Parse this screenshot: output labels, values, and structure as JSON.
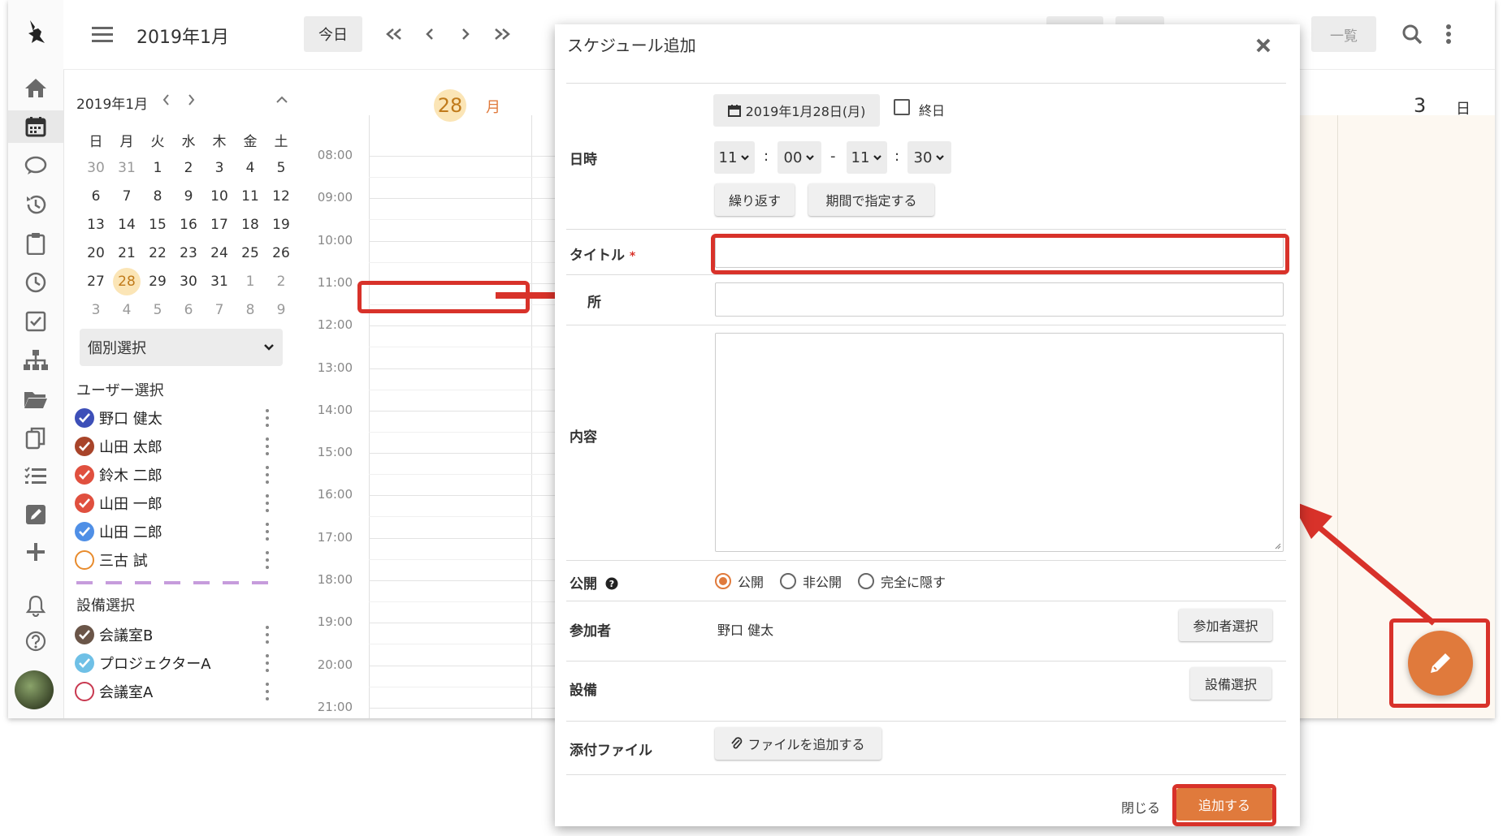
{
  "header": {
    "month_title": "2019年1月",
    "today_button": "今日",
    "view_list_label": "一覧"
  },
  "mini_calendar": {
    "title": "2019年1月",
    "weekdays": [
      "日",
      "月",
      "火",
      "水",
      "木",
      "金",
      "土"
    ],
    "weeks": [
      [
        "30",
        "31",
        "1",
        "2",
        "3",
        "4",
        "5"
      ],
      [
        "6",
        "7",
        "8",
        "9",
        "10",
        "11",
        "12"
      ],
      [
        "13",
        "14",
        "15",
        "16",
        "17",
        "18",
        "19"
      ],
      [
        "20",
        "21",
        "22",
        "23",
        "24",
        "25",
        "26"
      ],
      [
        "27",
        "28",
        "29",
        "30",
        "31",
        "1",
        "2"
      ],
      [
        "3",
        "4",
        "5",
        "6",
        "7",
        "8",
        "9"
      ]
    ],
    "today": "28"
  },
  "sidebar": {
    "group_select": "個別選択",
    "user_section": "ユーザー選択",
    "users": [
      {
        "name": "野口 健太",
        "color": "#3d4fb8",
        "checked": true
      },
      {
        "name": "山田 太郎",
        "color": "#a8442a",
        "checked": true
      },
      {
        "name": "鈴木 二郎",
        "color": "#e0503f",
        "checked": true
      },
      {
        "name": "山田 一郎",
        "color": "#e0503f",
        "checked": true
      },
      {
        "name": "山田 二郎",
        "color": "#4f8fe6",
        "checked": true
      },
      {
        "name": "三古 試",
        "color": "#e88b2d",
        "checked": false
      }
    ],
    "facility_section": "設備選択",
    "facilities": [
      {
        "name": "会議室B",
        "color": "#6a5548",
        "checked": true
      },
      {
        "name": "プロジェクターA",
        "color": "#6fc0e6",
        "checked": true
      },
      {
        "name": "会議室A",
        "color": "#c8384f",
        "checked": false
      }
    ]
  },
  "day_view": {
    "day_number": "28",
    "day_weekday": "月",
    "right_day_number": "3",
    "right_day_weekday": "日",
    "times": [
      "08:00",
      "09:00",
      "10:00",
      "11:00",
      "12:00",
      "13:00",
      "14:00",
      "15:00",
      "16:00",
      "17:00",
      "18:00",
      "19:00",
      "20:00",
      "21:00"
    ]
  },
  "modal": {
    "title": "スケジュール追加",
    "datetime_label": "日時",
    "date_button": "2019年1月28日(月)",
    "allday_label": "終日",
    "start_hour": "11",
    "start_min": "00",
    "end_hour": "11",
    "end_min": "30",
    "time_sep": ":",
    "range_sep": "-",
    "repeat_button": "繰り返す",
    "period_button": "期間で指定する",
    "title_label": "タイトル",
    "required_mark": "*",
    "place_label_partial": "所",
    "content_label": "内容",
    "visibility_label": "公開",
    "visibility_options": [
      "公開",
      "非公開",
      "完全に隠す"
    ],
    "participants_label": "参加者",
    "participant_name": "野口 健太",
    "participant_button": "参加者選択",
    "facility_label": "設備",
    "facility_button": "設備選択",
    "attachment_label": "添付ファイル",
    "attachment_button": "ファイルを追加する",
    "close_button": "閉じる",
    "add_button": "追加する"
  },
  "colors": {
    "accent": "#e07a3c",
    "annotation_red": "#d8322a",
    "today_highlight": "#fbe5b6"
  }
}
